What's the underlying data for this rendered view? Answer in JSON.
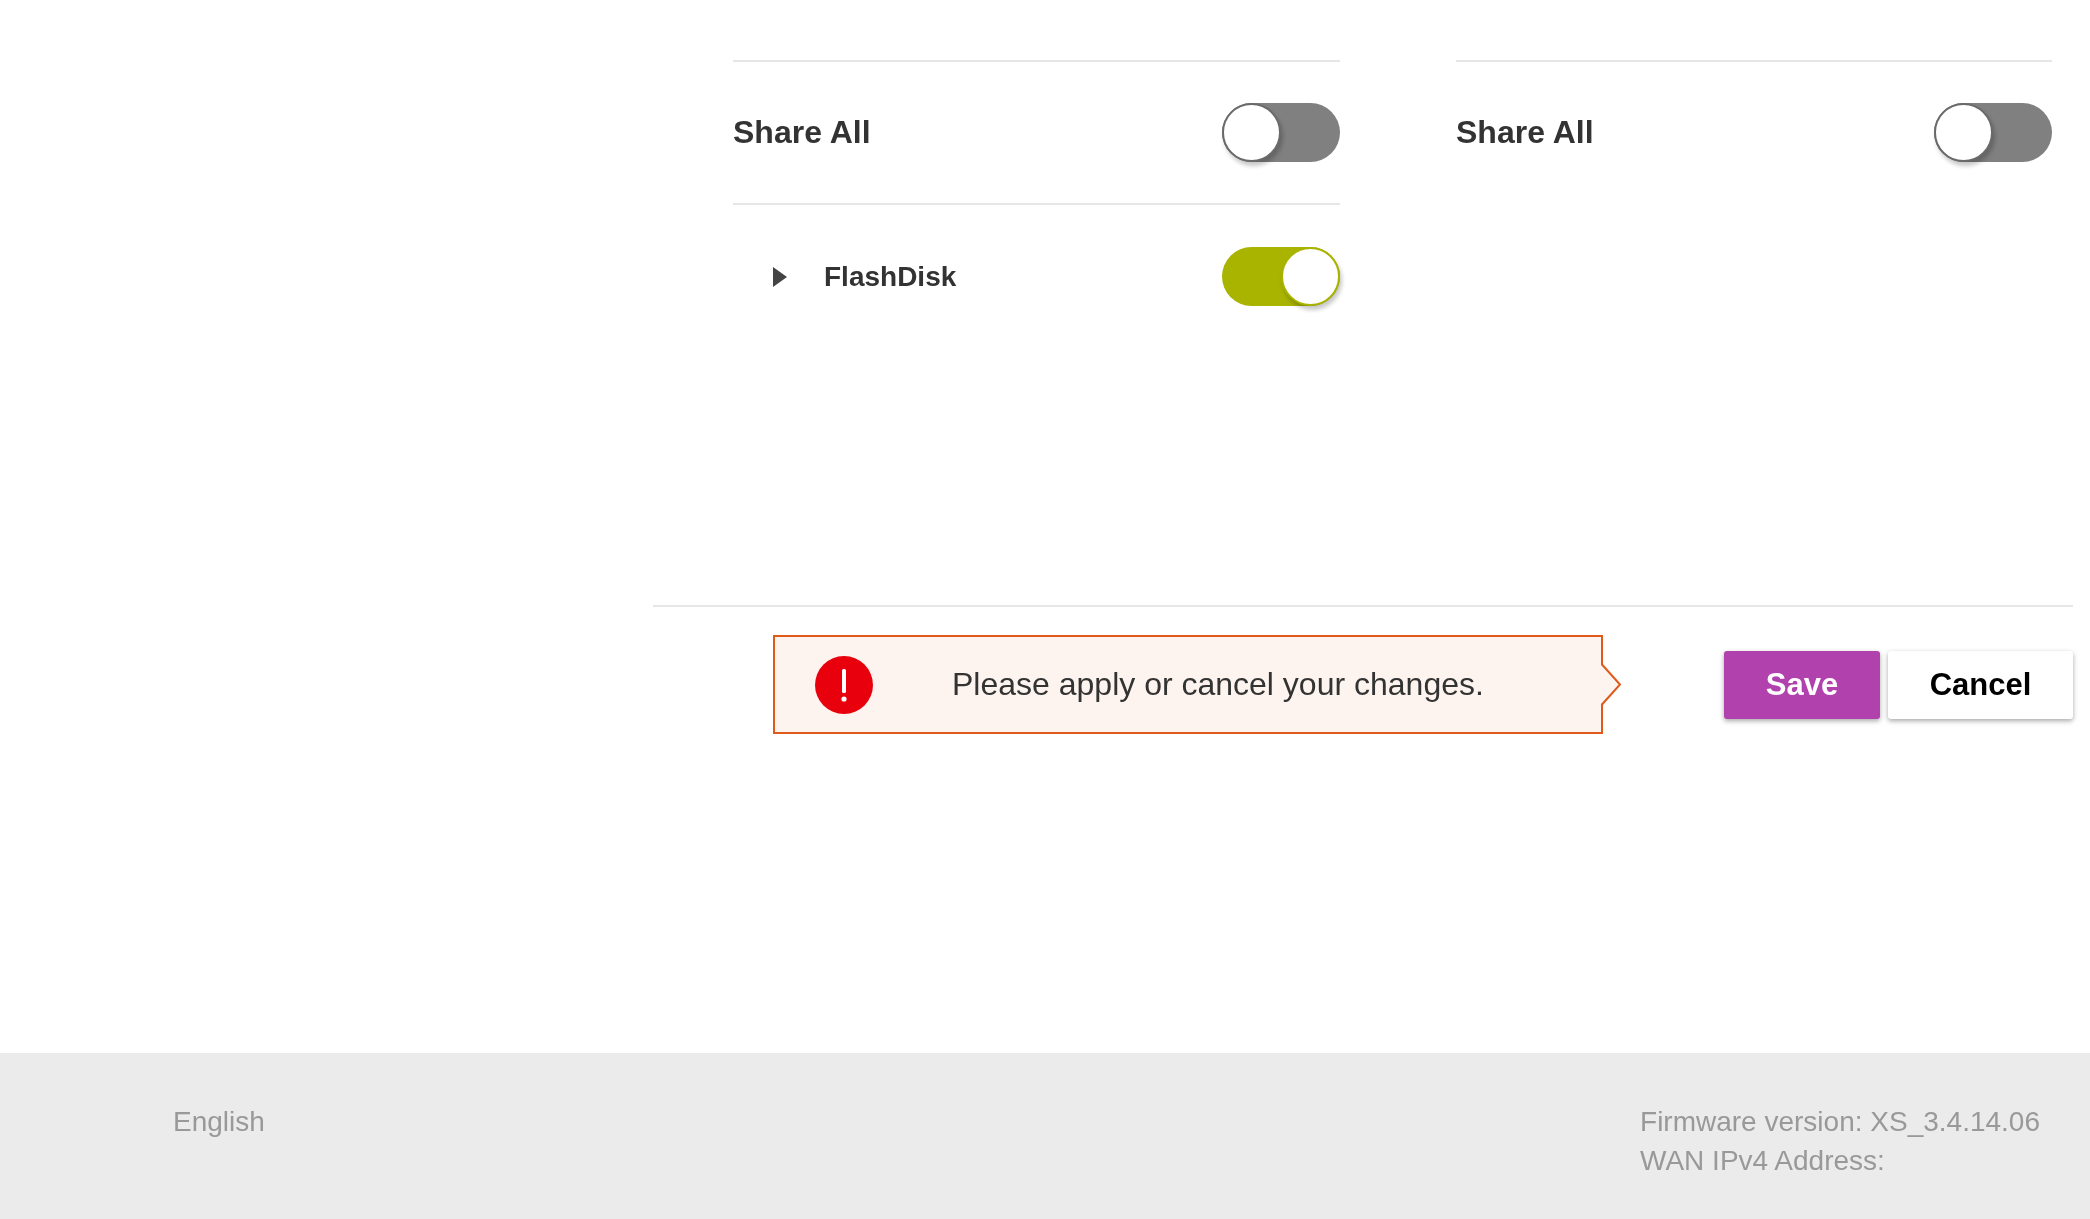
{
  "columns": [
    {
      "share_all": {
        "label": "Share All",
        "on": false
      },
      "items": [
        {
          "name": "FlashDisk",
          "expanded": false,
          "on": true
        }
      ]
    },
    {
      "share_all": {
        "label": "Share All",
        "on": false
      }
    }
  ],
  "alert": {
    "text": "Please apply or cancel your changes."
  },
  "buttons": [
    {
      "label": "Save",
      "kind": "primary"
    },
    {
      "label": "Cancel",
      "kind": "secondary"
    }
  ],
  "footer": {
    "language": "English",
    "firmware_version": "Firmware version: XS_3.4.14.06",
    "wan_ipv4_address": "WAN IPv4 Address:"
  }
}
